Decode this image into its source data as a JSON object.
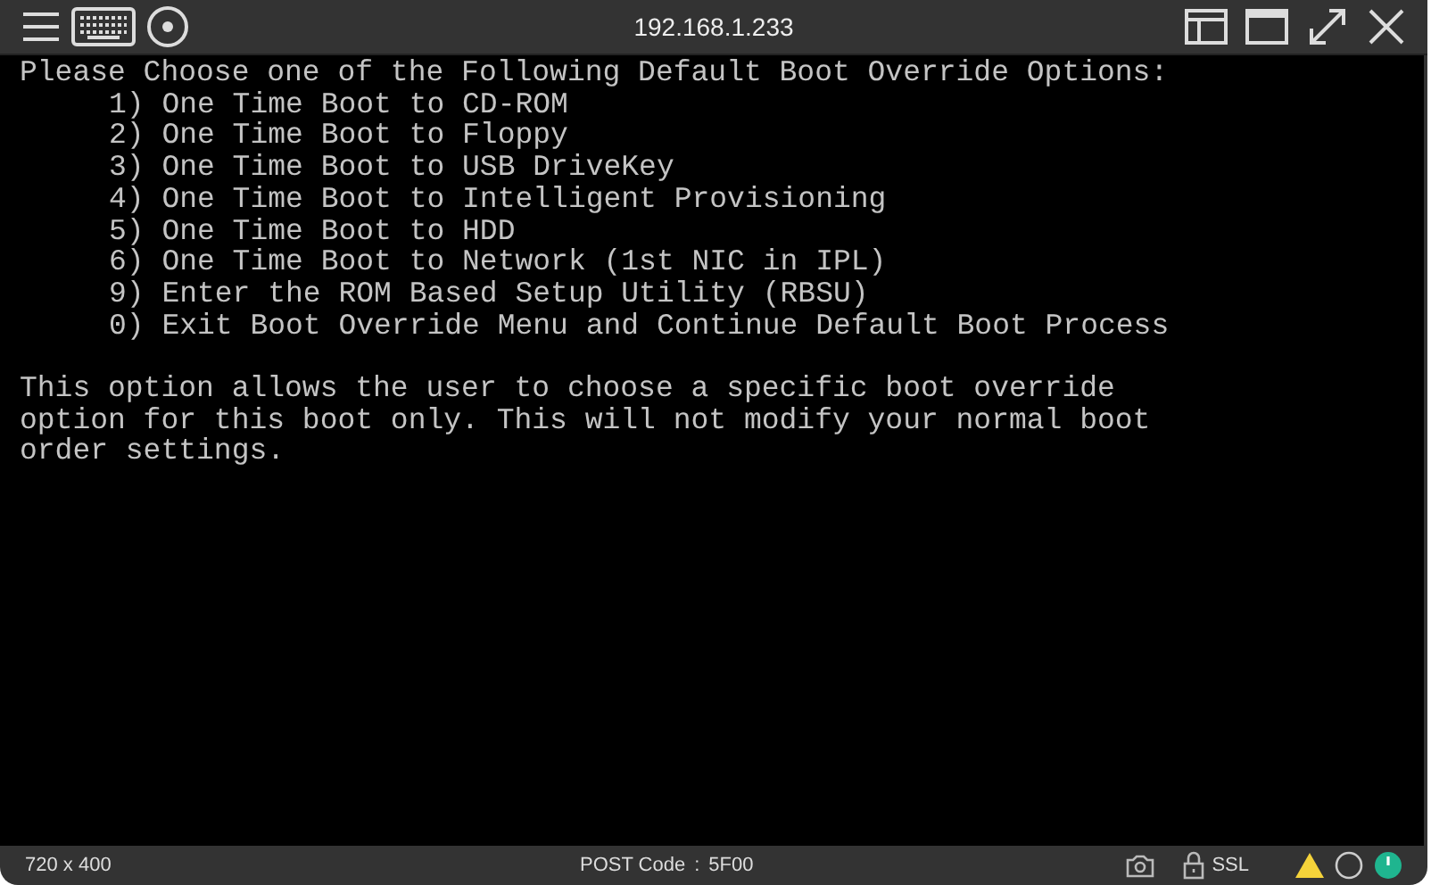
{
  "window": {
    "title": "192.168.1.233"
  },
  "console": {
    "heading": "Please Choose one of the Following Default Boot Override Options:",
    "options": [
      "1) One Time Boot to CD-ROM",
      "2) One Time Boot to Floppy",
      "3) One Time Boot to USB DriveKey",
      "4) One Time Boot to Intelligent Provisioning",
      "5) One Time Boot to HDD",
      "6) One Time Boot to Network (1st NIC in IPL)",
      "9) Enter the ROM Based Setup Utility (RBSU)",
      "0) Exit Boot Override Menu and Continue Default Boot Process"
    ],
    "description": [
      "This option allows the user to choose a specific boot override",
      "option for this boot only. This will not modify your normal boot",
      "order settings."
    ]
  },
  "status_bar": {
    "resolution": "720 x 400",
    "post_code_label": "POST Code",
    "post_code_separator": ":",
    "post_code": "5F00",
    "security": "SSL"
  }
}
